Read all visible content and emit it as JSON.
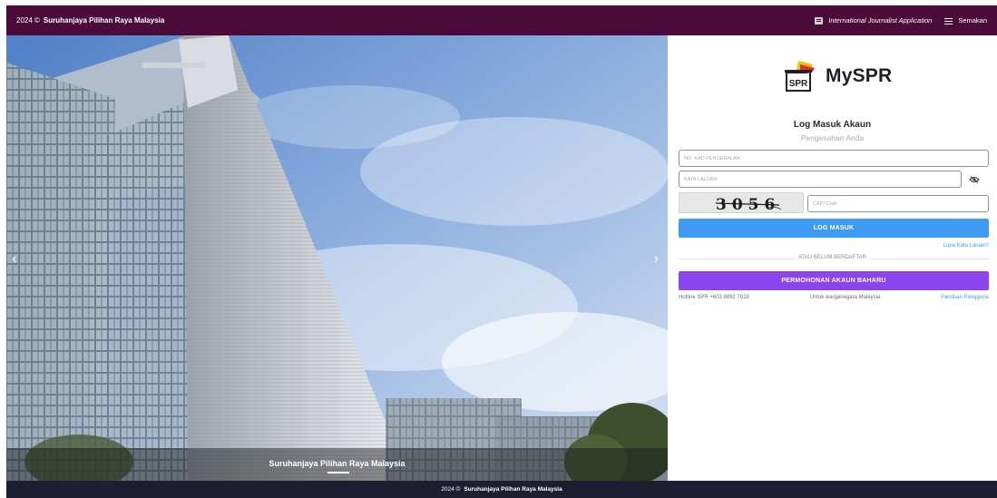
{
  "topbar": {
    "year": "2024 ©",
    "org": "Suruhanjaya Pilihan Raya Malaysia",
    "journalist_link": "International Journalist Application",
    "semakan_link": "Semakan",
    "journalist_icon": "document-icon",
    "semakan_icon": "list-icon"
  },
  "hero": {
    "caption": "Suruhanjaya Pilihan Raya Malaysia",
    "next_icon": "chevron-right-icon",
    "prev_icon": "chevron-left-icon"
  },
  "login": {
    "logo_text": "MySPR",
    "title": "Log Masuk Akaun",
    "subtitle": "Pengesahan Anda",
    "ic_placeholder": "NO. KAD PENGENALAN",
    "password_placeholder": "KATA LALUAN",
    "captcha_code": "3056",
    "captcha_placeholder": "CAPTCHA",
    "login_button": "LOG MASUK",
    "forgot_link": "Lupa Kata Laluan?",
    "divider_text": "ATAU BELUM BERDAFTAR",
    "register_button": "PERMOHONAN AKAUN BAHARU",
    "hotline": "Hotline SPR +603 8892 7018",
    "citizen_note": "Untuk warganegara Malaysia",
    "guide_link": "Panduan Pengguna"
  },
  "footer": {
    "year": "2024 ©",
    "org": "Suruhanjaya Pilihan Raya Malaysia"
  },
  "colors": {
    "topbar_bg": "#4a0a3a",
    "footer_bg": "#1e1e33",
    "login_button": "#3d9cf1",
    "register_button": "#8a45ef",
    "link": "#3d9cf1"
  }
}
